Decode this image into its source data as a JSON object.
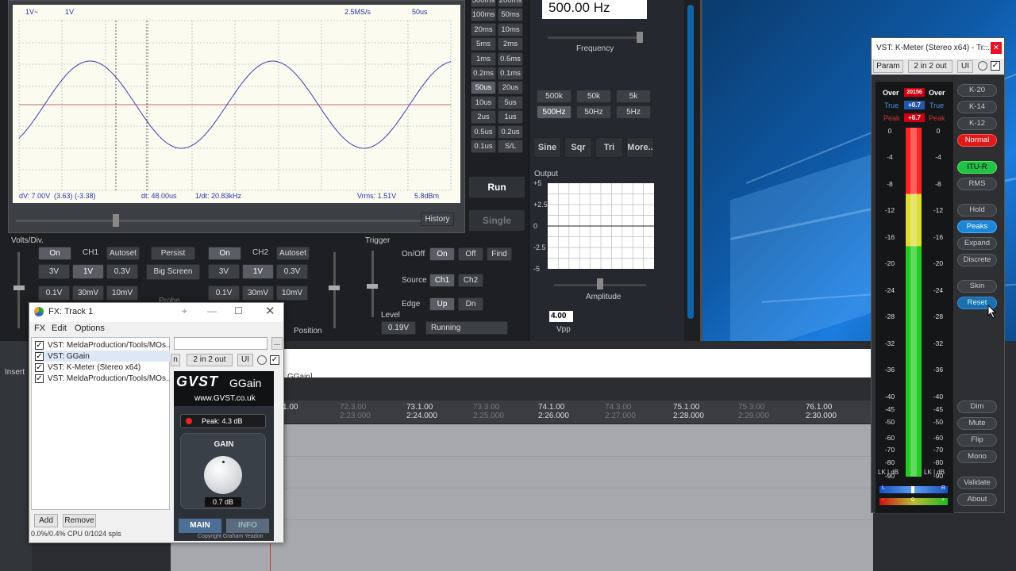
{
  "scope": {
    "top_left_ch1": "1V~",
    "top_ch_scale": "1V",
    "sample_rate": "2.5MS/s",
    "timebase": "50us",
    "dv": "dV: 7.00V",
    "dv_detail": "(3.63) (-3.38)",
    "dt": "dt: 48.00us",
    "inv_dt": "1/dt: 20.83kHz",
    "vrms": "Vrms: 1.51V",
    "dbm": "5.8dBm",
    "history": "History",
    "timebase_buttons": [
      "500ms",
      "200ms",
      "100ms",
      "50ms",
      "20ms",
      "10ms",
      "5ms",
      "2ms",
      "1ms",
      "0.5ms",
      "0.2ms",
      "0.1ms",
      "50us",
      "20us",
      "10us",
      "5us",
      "2us",
      "1us",
      "0.5us",
      "0.2us",
      "0.1us",
      "S/L"
    ],
    "volts_div_label": "Volts/Div.",
    "ch1": {
      "on": "On",
      "name": "CH1",
      "autoset": "Autoset",
      "scales": [
        "3V",
        "1V",
        "0.3V",
        "0.1V",
        "30mV",
        "10mV"
      ]
    },
    "ch2": {
      "on": "On",
      "name": "CH2",
      "autoset": "Autoset",
      "scales": [
        "3V",
        "1V",
        "0.3V",
        "0.1V",
        "30mV",
        "10mV"
      ]
    },
    "persist": "Persist",
    "big_screen": "Big Screen",
    "probe": "Probe",
    "position": "Position",
    "trigger": {
      "label": "Trigger",
      "onoff": "On/Off",
      "on": "On",
      "off": "Off",
      "find": "Find",
      "source": "Source",
      "ch1": "Ch1",
      "ch2": "Ch2",
      "edge": "Edge",
      "up": "Up",
      "dn": "Dn",
      "level": "Level",
      "level_value": "0.19V",
      "status": "Running"
    },
    "run": "Run",
    "single": "Single"
  },
  "generator": {
    "freq_display": "500.00 Hz",
    "frequency_label": "Frequency",
    "range_buttons": [
      "500k",
      "50k",
      "5k",
      "500Hz",
      "50Hz",
      "5Hz"
    ],
    "waves": [
      "Sine",
      "Sqr",
      "Tri",
      "More.."
    ],
    "output_label": "Output",
    "out_ticks": [
      "+5",
      "+2.5",
      "0",
      "-2.5",
      "-5"
    ],
    "amplitude_label": "Amplitude",
    "vpp_value": "4.00",
    "vpp_label": "Vpp"
  },
  "fx": {
    "title": "FX: Track 1",
    "menu": [
      "FX",
      "Edit",
      "Options"
    ],
    "items": [
      "VST: MeldaProduction/Tools/MOs...",
      "VST: GGain",
      "VST: K-Meter (Stereo x64)",
      "VST: MeldaProduction/Tools/MOs..."
    ],
    "add": "Add",
    "remove": "Remove",
    "cpu": "0.0%/0.4% CPU 0/1024 spls",
    "io": "2 in 2 out",
    "ui": "UI",
    "ellipsis": "..."
  },
  "ggain": {
    "logo": "GVST",
    "name": "GGain",
    "url": "www.GVST.co.uk",
    "peak": "Peak: 4.3 dB",
    "gain_label": "GAIN",
    "gain_value": "0.7 dB",
    "tab_main": "MAIN",
    "tab_info": "INFO",
    "copyright": "Copyright Graham Yeadon"
  },
  "kmeter": {
    "title": "VST: K-Meter (Stereo x64) - Tr...",
    "param": "Param",
    "io": "2 in 2 out",
    "ui": "UI",
    "over": "Over",
    "over_count": "20156",
    "true": "True",
    "true_val": "+0.7",
    "peak": "Peak",
    "peak_val": "+0.7",
    "scale": [
      "0",
      "-4",
      "-8",
      "-12",
      "-16",
      "-20",
      "-24",
      "-28",
      "-32",
      "-36",
      "-40",
      "-45",
      "-50",
      "-60",
      "-70",
      "-80",
      "-90"
    ],
    "lk": "LK | dB",
    "buttons_top": [
      "K-20",
      "K-14",
      "K-12",
      "Normal",
      "ITU-R",
      "RMS",
      "Hold",
      "Peaks",
      "Expand",
      "Discrete",
      "Skin",
      "Reset"
    ],
    "buttons_bottom": [
      "Dim",
      "Mute",
      "Flip",
      "Mono",
      "Validate",
      "About"
    ],
    "lr_l": "L",
    "lr_r": "R",
    "corr_neg": "-",
    "corr_zero": "0",
    "corr_pos": "+"
  },
  "ruler": {
    "ticks": [
      {
        "bar": "1.00",
        "time": ""
      },
      {
        "bar": "72.3.00",
        "time": "2:23.000"
      },
      {
        "bar": "73.1.00",
        "time": "2:24.000"
      },
      {
        "bar": "73.3.00",
        "time": "2:25.000"
      },
      {
        "bar": "74.1.00",
        "time": "2:26.000"
      },
      {
        "bar": "74.3.00",
        "time": "2:27.000"
      },
      {
        "bar": "75.1.00",
        "time": "2:28.000"
      },
      {
        "bar": "75.3.00",
        "time": "2:29.000"
      },
      {
        "bar": "76.1.00",
        "time": "2:30.000"
      }
    ],
    "ggain_tab": "GGain]",
    "insert": "Insert"
  }
}
